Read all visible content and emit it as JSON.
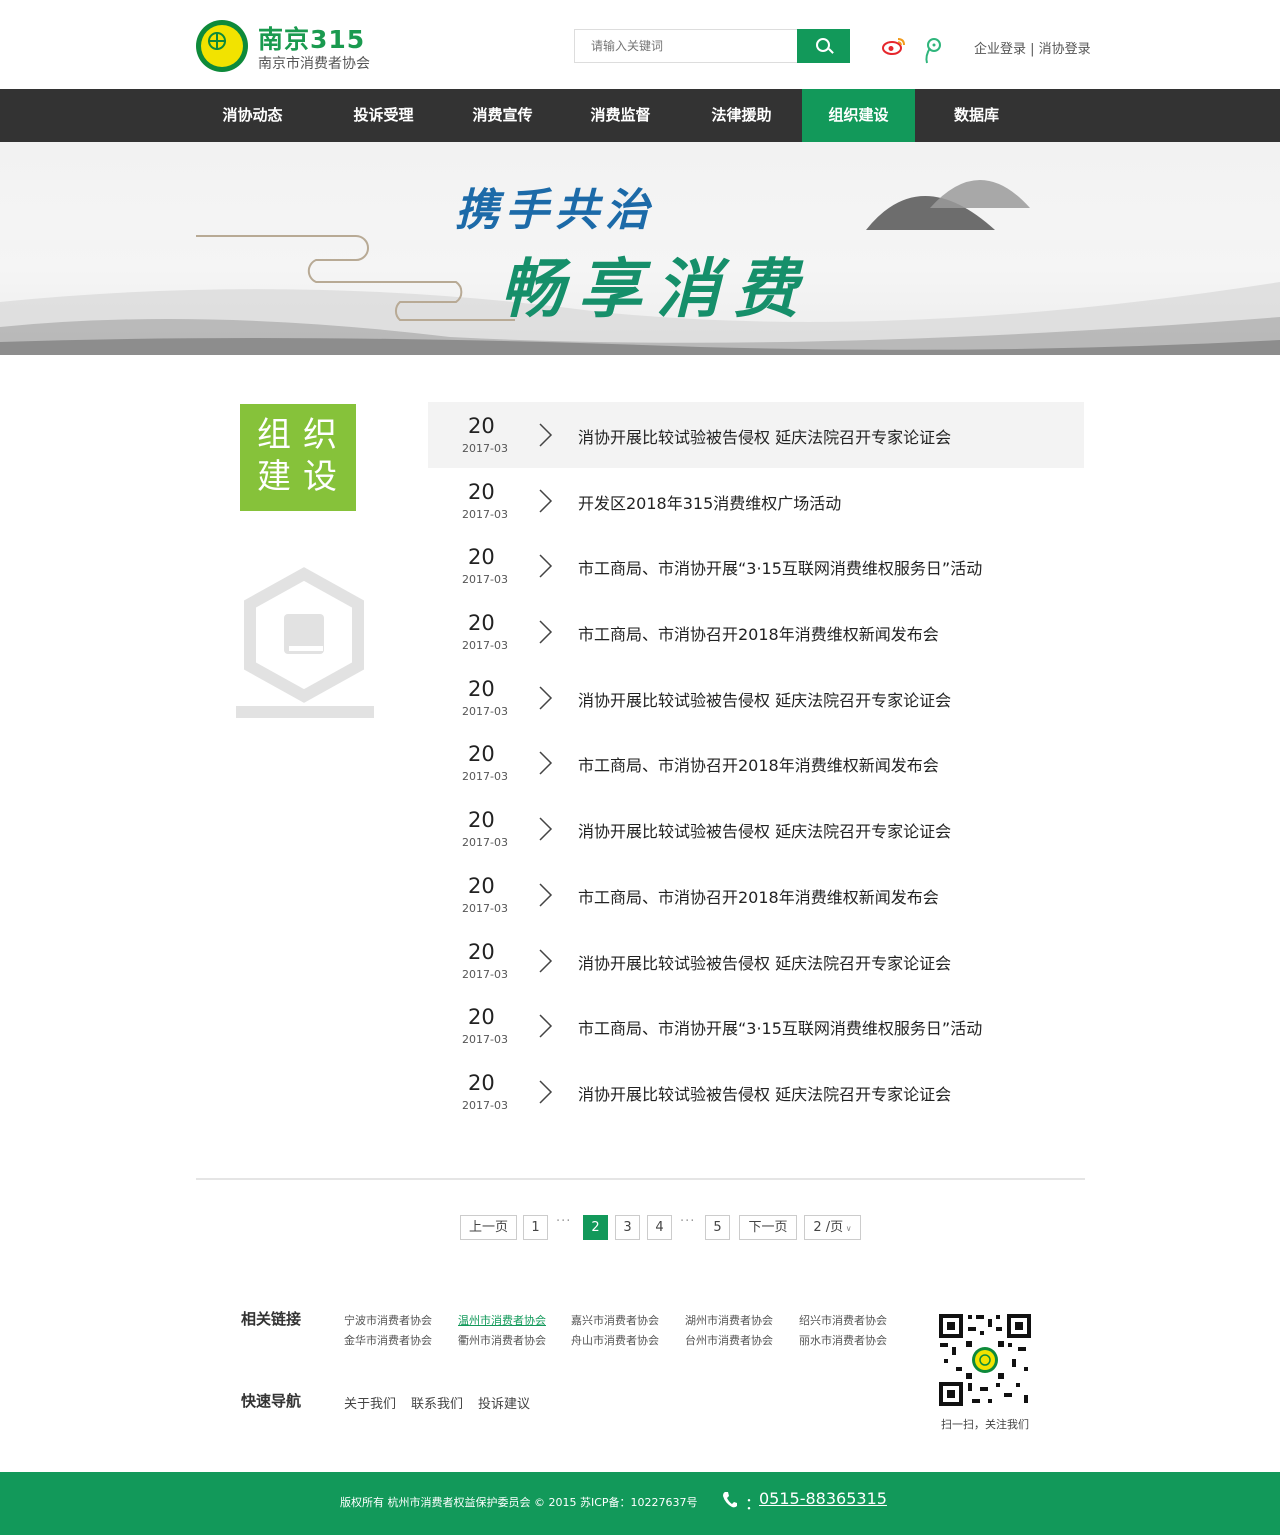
{
  "header": {
    "logo_title": "南京315",
    "logo_subtitle": "南京市消费者协会",
    "search_placeholder": "请输入关键词",
    "login_enterprise": "企业登录",
    "login_separator": " | ",
    "login_consumer": "消协登录",
    "icons": [
      "weibo-icon",
      "tencent-weibo-icon",
      "search-icon"
    ]
  },
  "nav": {
    "items": [
      {
        "label": "消协动态"
      },
      {
        "label": "投诉受理"
      },
      {
        "label": "消费宣传"
      },
      {
        "label": "消费监督"
      },
      {
        "label": "法律援助"
      },
      {
        "label": "组织建设",
        "active": true
      },
      {
        "label": "数据库"
      }
    ]
  },
  "banner": {
    "line1": "携手共治",
    "line2": "畅享消费"
  },
  "sidebar": {
    "title_line1": "组织",
    "title_line2": "建设",
    "icon": "book-hexagon-icon"
  },
  "news": [
    {
      "day": "20",
      "ym": "2017-03",
      "title": "消协开展比较试验被告侵权 延庆法院召开专家论证会"
    },
    {
      "day": "20",
      "ym": "2017-03",
      "title": "开发区2018年315消费维权广场活动"
    },
    {
      "day": "20",
      "ym": "2017-03",
      "title": "市工商局、市消协开展“3·15互联网消费维权服务日”活动"
    },
    {
      "day": "20",
      "ym": "2017-03",
      "title": "市工商局、市消协召开2018年消费维权新闻发布会"
    },
    {
      "day": "20",
      "ym": "2017-03",
      "title": "消协开展比较试验被告侵权 延庆法院召开专家论证会"
    },
    {
      "day": "20",
      "ym": "2017-03",
      "title": "市工商局、市消协召开2018年消费维权新闻发布会"
    },
    {
      "day": "20",
      "ym": "2017-03",
      "title": "消协开展比较试验被告侵权 延庆法院召开专家论证会"
    },
    {
      "day": "20",
      "ym": "2017-03",
      "title": "市工商局、市消协召开2018年消费维权新闻发布会"
    },
    {
      "day": "20",
      "ym": "2017-03",
      "title": "消协开展比较试验被告侵权 延庆法院召开专家论证会"
    },
    {
      "day": "20",
      "ym": "2017-03",
      "title": "市工商局、市消协开展“3·15互联网消费维权服务日”活动"
    },
    {
      "day": "20",
      "ym": "2017-03",
      "title": "消协开展比较试验被告侵权 延庆法院召开专家论证会"
    }
  ],
  "pagination": {
    "prev": "上一页",
    "p1": "1",
    "dots1": "···",
    "p2": "2",
    "p3": "3",
    "p4": "4",
    "dots2": "···",
    "p5": "5",
    "next": "下一页",
    "per_page": "2 /页",
    "current_page": 2
  },
  "footer": {
    "related_label": "相关链接",
    "related_links": [
      "宁波市消费者协会",
      "温州市消费者协会",
      "嘉兴市消费者协会",
      "湖州市消费者协会",
      "绍兴市消费者协会",
      "金华市消费者协会",
      "衢州市消费者协会",
      "舟山市消费者协会",
      "台州市消费者协会",
      "丽水市消费者协会"
    ],
    "quick_label": "快速导航",
    "quick_links": [
      "关于我们",
      "联系我们",
      "投诉建议"
    ],
    "qr_caption": "扫一扫，关注我们",
    "copyright": "版权所有 杭州市消费者权益保护委员会 © 2015 苏ICP备：10227637号",
    "phone_colon": "：",
    "phone": "0515-88365315"
  },
  "colors": {
    "brand_green": "#12995a",
    "nav_bg": "#333333",
    "sidebar_green": "#86c23a"
  }
}
